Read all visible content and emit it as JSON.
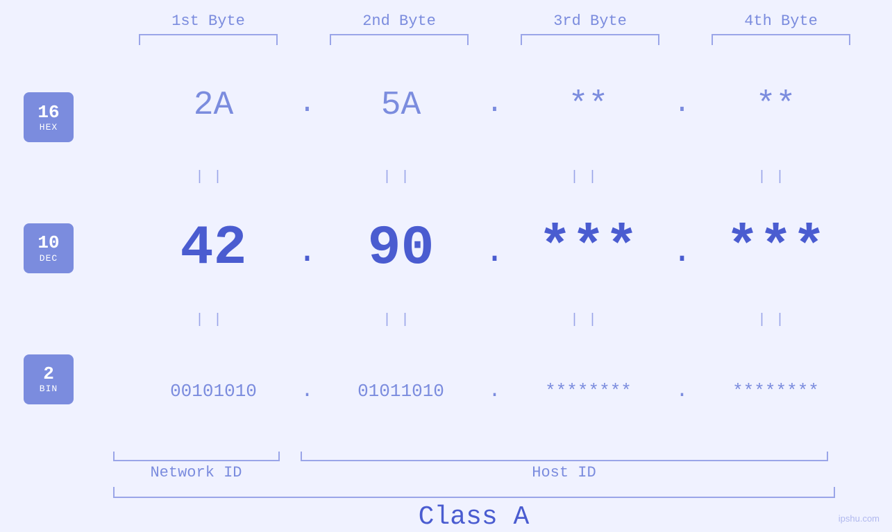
{
  "header": {
    "byte1": "1st Byte",
    "byte2": "2nd Byte",
    "byte3": "3rd Byte",
    "byte4": "4th Byte"
  },
  "badges": [
    {
      "num": "16",
      "label": "HEX"
    },
    {
      "num": "10",
      "label": "DEC"
    },
    {
      "num": "2",
      "label": "BIN"
    }
  ],
  "rows": {
    "hex": {
      "b1": "2A",
      "b2": "5A",
      "b3": "**",
      "b4": "**",
      "dot": "."
    },
    "dec": {
      "b1": "42",
      "b2": "90",
      "b3": "***",
      "b4": "***",
      "dot": "."
    },
    "bin": {
      "b1": "00101010",
      "b2": "01011010",
      "b3": "********",
      "b4": "********",
      "dot": "."
    }
  },
  "labels": {
    "network_id": "Network ID",
    "host_id": "Host ID",
    "class": "Class A"
  },
  "watermark": "ipshu.com",
  "pipes": "||",
  "colors": {
    "accent": "#7b8cde",
    "strong": "#4a5cd0",
    "light": "#9aa5e8",
    "bg": "#f0f2ff"
  }
}
